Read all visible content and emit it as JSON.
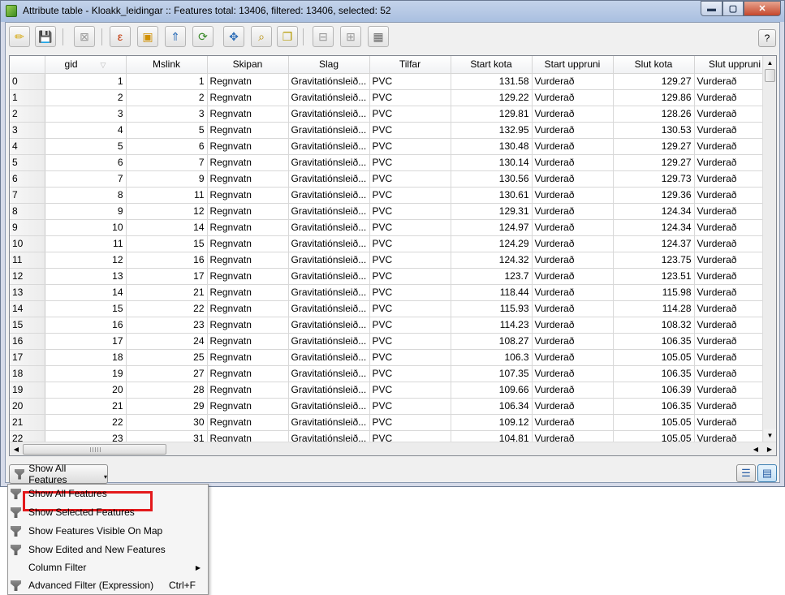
{
  "window": {
    "title": "Attribute table - Kloakk_leidingar :: Features total: 13406, filtered: 13406, selected: 52",
    "min_glyph": "▬",
    "max_glyph": "▢",
    "close_glyph": "✕"
  },
  "toolbar": {
    "items": [
      {
        "name": "toggle-editing-icon",
        "glyph": "✏",
        "color": "#d4a300",
        "disabled": false
      },
      {
        "name": "save-edits-icon",
        "glyph": "💾",
        "color": "#9a9a9a",
        "disabled": true
      },
      {
        "name": "delete-selected-icon",
        "glyph": "⊠",
        "color": "#9a9a9a",
        "disabled": true
      },
      {
        "name": "expression-select-icon",
        "glyph": "ε",
        "color": "#c03000",
        "disabled": false
      },
      {
        "name": "deselect-all-icon",
        "glyph": "▣",
        "color": "#d09000",
        "disabled": false
      },
      {
        "name": "move-selection-top-icon",
        "glyph": "⇑",
        "color": "#2f6fb8",
        "disabled": false
      },
      {
        "name": "invert-selection-icon",
        "glyph": "⟳",
        "color": "#3a8a2a",
        "disabled": false
      },
      {
        "name": "pan-to-selected-icon",
        "glyph": "✥",
        "color": "#2f6fb8",
        "disabled": false
      },
      {
        "name": "zoom-to-selected-icon",
        "glyph": "⌕",
        "color": "#b58a00",
        "disabled": false
      },
      {
        "name": "copy-rows-icon",
        "glyph": "❐",
        "color": "#b59a00",
        "disabled": false
      },
      {
        "name": "delete-column-icon",
        "glyph": "⊟",
        "color": "#9a9a9a",
        "disabled": true
      },
      {
        "name": "new-column-icon",
        "glyph": "⊞",
        "color": "#9a9a9a",
        "disabled": true
      },
      {
        "name": "field-calculator-icon",
        "glyph": "▦",
        "color": "#6b6b6b",
        "disabled": false
      }
    ],
    "help_label": "?"
  },
  "table": {
    "columns": [
      "gid",
      "Mslink",
      "Skipan",
      "Slag",
      "Tilfar",
      "Start kota",
      "Start uppruni",
      "Slut kota",
      "Slut uppruni"
    ],
    "sort_indicator": "▽",
    "rows": [
      [
        "0",
        "1",
        "1",
        "Regnvatn",
        "Gravitatiónsleið...",
        "PVC",
        "131.58",
        "Vurderað",
        "129.27",
        "Vurderað"
      ],
      [
        "1",
        "2",
        "2",
        "Regnvatn",
        "Gravitatiónsleið...",
        "PVC",
        "129.22",
        "Vurderað",
        "129.86",
        "Vurderað"
      ],
      [
        "2",
        "3",
        "3",
        "Regnvatn",
        "Gravitatiónsleið...",
        "PVC",
        "129.81",
        "Vurderað",
        "128.26",
        "Vurderað"
      ],
      [
        "3",
        "4",
        "5",
        "Regnvatn",
        "Gravitatiónsleið...",
        "PVC",
        "132.95",
        "Vurderað",
        "130.53",
        "Vurderað"
      ],
      [
        "4",
        "5",
        "6",
        "Regnvatn",
        "Gravitatiónsleið...",
        "PVC",
        "130.48",
        "Vurderað",
        "129.27",
        "Vurderað"
      ],
      [
        "5",
        "6",
        "7",
        "Regnvatn",
        "Gravitatiónsleið...",
        "PVC",
        "130.14",
        "Vurderað",
        "129.27",
        "Vurderað"
      ],
      [
        "6",
        "7",
        "9",
        "Regnvatn",
        "Gravitatiónsleið...",
        "PVC",
        "130.56",
        "Vurderað",
        "129.73",
        "Vurderað"
      ],
      [
        "7",
        "8",
        "11",
        "Regnvatn",
        "Gravitatiónsleið...",
        "PVC",
        "130.61",
        "Vurderað",
        "129.36",
        "Vurderað"
      ],
      [
        "8",
        "9",
        "12",
        "Regnvatn",
        "Gravitatiónsleið...",
        "PVC",
        "129.31",
        "Vurderað",
        "124.34",
        "Vurderað"
      ],
      [
        "9",
        "10",
        "14",
        "Regnvatn",
        "Gravitatiónsleið...",
        "PVC",
        "124.97",
        "Vurderað",
        "124.34",
        "Vurderað"
      ],
      [
        "10",
        "11",
        "15",
        "Regnvatn",
        "Gravitatiónsleið...",
        "PVC",
        "124.29",
        "Vurderað",
        "124.37",
        "Vurderað"
      ],
      [
        "11",
        "12",
        "16",
        "Regnvatn",
        "Gravitatiónsleið...",
        "PVC",
        "124.32",
        "Vurderað",
        "123.75",
        "Vurderað"
      ],
      [
        "12",
        "13",
        "17",
        "Regnvatn",
        "Gravitatiónsleið...",
        "PVC",
        "123.7",
        "Vurderað",
        "123.51",
        "Vurderað"
      ],
      [
        "13",
        "14",
        "21",
        "Regnvatn",
        "Gravitatiónsleið...",
        "PVC",
        "118.44",
        "Vurderað",
        "115.98",
        "Vurderað"
      ],
      [
        "14",
        "15",
        "22",
        "Regnvatn",
        "Gravitatiónsleið...",
        "PVC",
        "115.93",
        "Vurderað",
        "114.28",
        "Vurderað"
      ],
      [
        "15",
        "16",
        "23",
        "Regnvatn",
        "Gravitatiónsleið...",
        "PVC",
        "114.23",
        "Vurderað",
        "108.32",
        "Vurderað"
      ],
      [
        "16",
        "17",
        "24",
        "Regnvatn",
        "Gravitatiónsleið...",
        "PVC",
        "108.27",
        "Vurderað",
        "106.35",
        "Vurderað"
      ],
      [
        "17",
        "18",
        "25",
        "Regnvatn",
        "Gravitatiónsleið...",
        "PVC",
        "106.3",
        "Vurderað",
        "105.05",
        "Vurderað"
      ],
      [
        "18",
        "19",
        "27",
        "Regnvatn",
        "Gravitatiónsleið...",
        "PVC",
        "107.35",
        "Vurderað",
        "106.35",
        "Vurderað"
      ],
      [
        "19",
        "20",
        "28",
        "Regnvatn",
        "Gravitatiónsleið...",
        "PVC",
        "109.66",
        "Vurderað",
        "106.39",
        "Vurderað"
      ],
      [
        "20",
        "21",
        "29",
        "Regnvatn",
        "Gravitatiónsleið...",
        "PVC",
        "106.34",
        "Vurderað",
        "106.35",
        "Vurderað"
      ],
      [
        "21",
        "22",
        "30",
        "Regnvatn",
        "Gravitatiónsleið...",
        "PVC",
        "109.12",
        "Vurderað",
        "105.05",
        "Vurderað"
      ],
      [
        "22",
        "23",
        "31",
        "Regnvatn",
        "Gravitatiónsleið...",
        "PVC",
        "104.81",
        "Vurderað",
        "105.05",
        "Vurderað"
      ]
    ]
  },
  "filter_button": {
    "label": "Show All Features",
    "arrow": "▾"
  },
  "view_buttons": {
    "form_view_glyph": "☰",
    "table_view_glyph": "▤"
  },
  "menu": {
    "items": [
      {
        "label": "Show All Features",
        "shortcut": "",
        "icon": true,
        "submenu": false
      },
      {
        "label": "Show Selected Features",
        "shortcut": "",
        "icon": true,
        "submenu": false,
        "highlighted": true
      },
      {
        "label": "Show Features Visible On Map",
        "shortcut": "",
        "icon": true,
        "submenu": false
      },
      {
        "label": "Show Edited and New Features",
        "shortcut": "",
        "icon": true,
        "submenu": false
      },
      {
        "label": "Column Filter",
        "shortcut": "",
        "icon": false,
        "submenu": true
      },
      {
        "label": "Advanced Filter (Expression)",
        "shortcut": "Ctrl+F",
        "icon": true,
        "submenu": false
      }
    ],
    "submenu_glyph": "▶",
    "highlight_color": "#e3191b"
  }
}
